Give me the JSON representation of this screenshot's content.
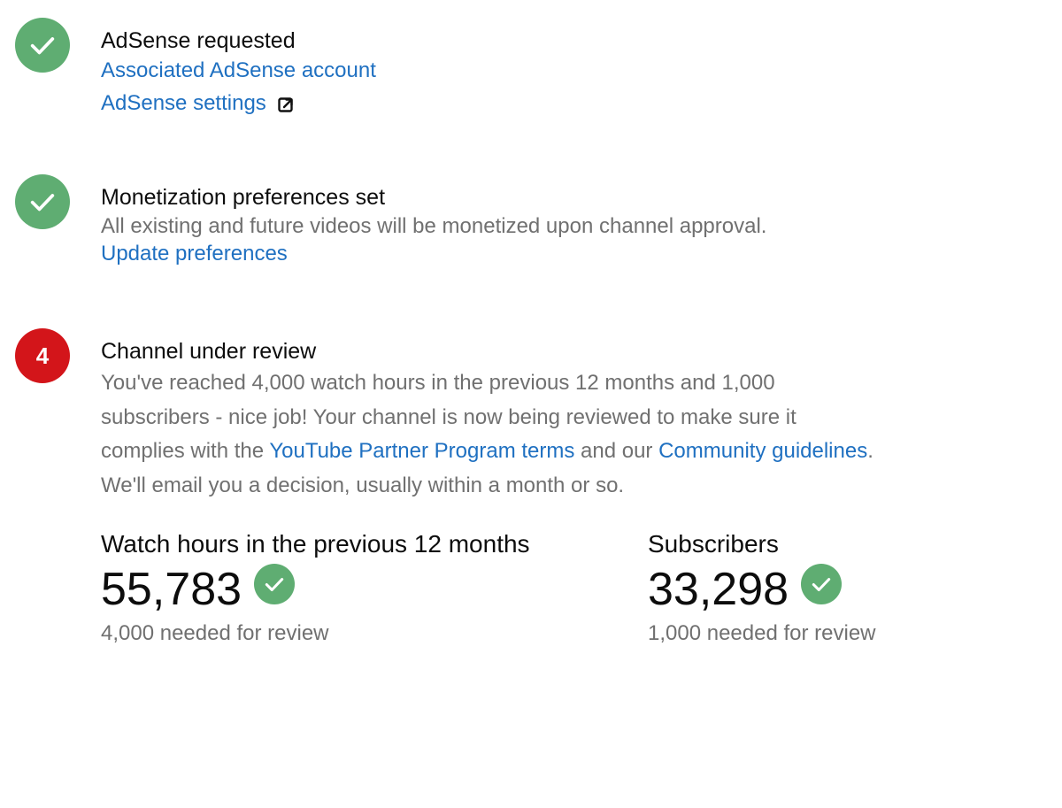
{
  "colors": {
    "done_green": "#5fad72",
    "pending_red": "#d3151a",
    "link_blue": "#1f70c1",
    "muted_text": "#707070"
  },
  "steps": [
    {
      "status": "done",
      "icon": "check-icon",
      "title": "AdSense requested",
      "links": [
        "Associated AdSense account",
        "AdSense settings"
      ],
      "external_icon": "external-link-icon"
    },
    {
      "status": "done",
      "icon": "check-icon",
      "title": "Monetization preferences set",
      "description": "All existing and future videos will be monetized upon channel approval.",
      "link": "Update preferences"
    },
    {
      "status": "pending",
      "number": "4",
      "title": "Channel under review",
      "description": {
        "line1": "You've reached 4,000 watch hours in the previous 12 months and 1,000",
        "line2": "subscribers - nice job! Your channel is now being reviewed to make sure it",
        "line3_prefix": "complies with the ",
        "line3_link1": "YouTube Partner Program terms",
        "line3_middle": " and our ",
        "line3_link2": "Community guidelines",
        "line3_suffix": ".",
        "line4": "We'll email you a decision, usually within a month or so."
      }
    }
  ],
  "stats": {
    "watch_hours": {
      "label": "Watch hours in the previous 12 months",
      "value": "55,783",
      "note": "4,000 needed for review"
    },
    "subscribers": {
      "label": "Subscribers",
      "value": "33,298",
      "note": "1,000 needed for review"
    }
  }
}
